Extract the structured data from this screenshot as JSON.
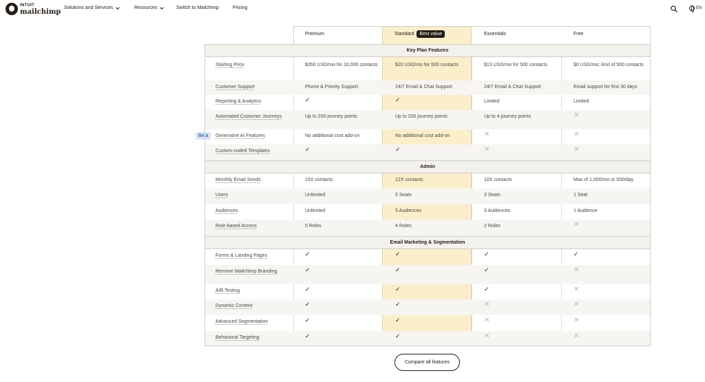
{
  "header": {
    "logo_top": "INTUIT",
    "logo_main": "mailchimp",
    "nav": [
      {
        "label": "Solutions and Services",
        "dropdown": true
      },
      {
        "label": "Resources",
        "dropdown": true
      },
      {
        "label": "Switch to Mailchimp",
        "dropdown": false
      },
      {
        "label": "Pricing",
        "dropdown": false
      }
    ],
    "lang": "EN"
  },
  "plans": {
    "premium": "Premium",
    "standard": "Standard",
    "standard_badge": "Best value",
    "essentials": "Essentials",
    "free": "Free"
  },
  "beta_tag": "Beta",
  "sections": [
    {
      "title": "Key Plan Features",
      "rows": [
        {
          "feature": "Starting Price",
          "premium": "$350 USD/mo for 10,000 contacts",
          "standard": "$20 USD/mo for 500 contacts",
          "essentials": "$13 USD/mo for 500 contacts",
          "free": "$0 USD/mo; limit of 500 contacts"
        },
        {
          "feature": "Customer Support",
          "premium": "Phone & Priority Support",
          "standard": "24/7 Email & Chat Support",
          "essentials": "24/7 Email & Chat Support",
          "free": "Email support for first 30 days"
        },
        {
          "feature": "Reporting & Analytics",
          "premium": "✓",
          "standard": "✓",
          "essentials": "Limited",
          "free": "Limited"
        },
        {
          "feature": "Automated Customer Journeys",
          "premium": "Up to 200 journey points",
          "standard": "Up to 200 journey points",
          "essentials": "Up to 4 journey points",
          "free": "✕"
        },
        {
          "feature": "Generative AI Features",
          "premium": "No additional cost add-on",
          "standard": "No additional cost add-on",
          "essentials": "✕",
          "free": "✕"
        },
        {
          "feature": "Custom-coded Templates",
          "premium": "✓",
          "standard": "✓",
          "essentials": "✕",
          "free": "✕"
        }
      ]
    },
    {
      "title": "Admin",
      "rows": [
        {
          "feature": "Monthly Email Sends",
          "premium": "15X contacts",
          "standard": "12X contacts",
          "essentials": "10X contacts",
          "free": "Max of 1,000/mo or 500/day"
        },
        {
          "feature": "Users",
          "premium": "Unlimited",
          "standard": "5 Seats",
          "essentials": "3 Seats",
          "free": "1 Seat"
        },
        {
          "feature": "Audiences",
          "premium": "Unlimited",
          "standard": "5 Audiences",
          "essentials": "3 Audiences",
          "free": "1 Audience"
        },
        {
          "feature": "Role-based Access",
          "premium": "5 Roles",
          "standard": "4 Roles",
          "essentials": "2 Roles",
          "free": "✕"
        }
      ]
    },
    {
      "title": "Email Marketing & Segmentation",
      "rows": [
        {
          "feature": "Forms & Landing Pages",
          "premium": "✓",
          "standard": "✓",
          "essentials": "✓",
          "free": "✓"
        },
        {
          "feature": "Remove Mailchimp Branding",
          "premium": "✓",
          "standard": "✓",
          "essentials": "✓",
          "free": "✕"
        },
        {
          "feature": "A/B Testing",
          "premium": "✓",
          "standard": "✓",
          "essentials": "✓",
          "free": "✕"
        },
        {
          "feature": "Dynamic Content",
          "premium": "✓",
          "standard": "✓",
          "essentials": "✕",
          "free": "✕"
        },
        {
          "feature": "Advanced Segmentation",
          "premium": "✓",
          "standard": "✓",
          "essentials": "✕",
          "free": "✕"
        },
        {
          "feature": "Behavioral Targeting",
          "premium": "✓",
          "standard": "✓",
          "essentials": "✕",
          "free": "✕"
        }
      ]
    }
  ],
  "compare_button": "Compare all features"
}
